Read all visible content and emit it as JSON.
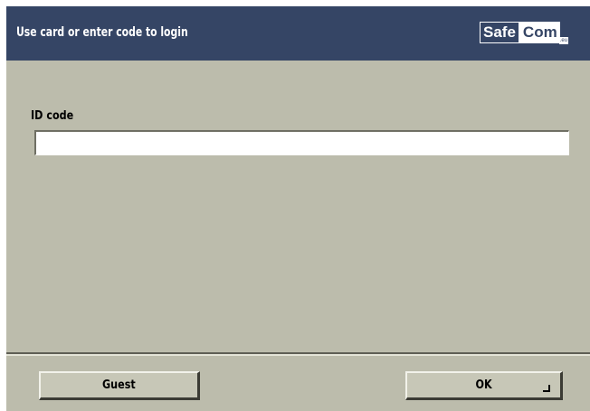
{
  "header": {
    "title": "Use card or enter code to login",
    "background_color": "#354565",
    "logo": {
      "part1": "Safe",
      "part2": "Com",
      "suffix": ".eu"
    }
  },
  "form": {
    "id_label": "ID code",
    "id_value": "",
    "id_placeholder": ""
  },
  "footer": {
    "guest_label": "Guest",
    "ok_label": "OK",
    "ok_icon": "enter-key-icon"
  },
  "colors": {
    "panel": "#bcbcac",
    "button": "#c7c7b7"
  }
}
